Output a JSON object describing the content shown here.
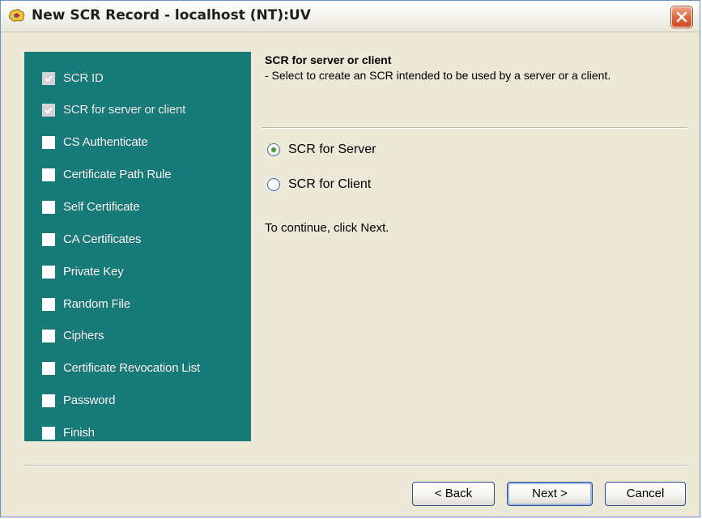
{
  "window": {
    "title": "New SCR Record - localhost (NT):UV"
  },
  "steps": [
    {
      "label": "SCR ID",
      "done": true
    },
    {
      "label": "SCR for server or client",
      "done": true
    },
    {
      "label": "CS Authenticate",
      "done": false
    },
    {
      "label": "Certificate Path Rule",
      "done": false
    },
    {
      "label": "Self Certificate",
      "done": false
    },
    {
      "label": "CA Certificates",
      "done": false
    },
    {
      "label": "Private Key",
      "done": false
    },
    {
      "label": "Random File",
      "done": false
    },
    {
      "label": "Ciphers",
      "done": false
    },
    {
      "label": "Certificate Revocation List",
      "done": false
    },
    {
      "label": "Password",
      "done": false
    },
    {
      "label": "Finish",
      "done": false
    }
  ],
  "content": {
    "heading": "SCR for server or client",
    "description": " - Select to create an SCR intended to be used by a server or a client.",
    "options": [
      {
        "label": "SCR for Server",
        "selected": true
      },
      {
        "label": "SCR for Client",
        "selected": false
      }
    ],
    "continue_text": "To continue, click Next."
  },
  "buttons": {
    "back": "< Back",
    "next": "Next >",
    "cancel": "Cancel"
  },
  "colors": {
    "step_panel": "#177b79",
    "radio_selected": "#3b9c2f",
    "close_button": "#e0683f"
  }
}
